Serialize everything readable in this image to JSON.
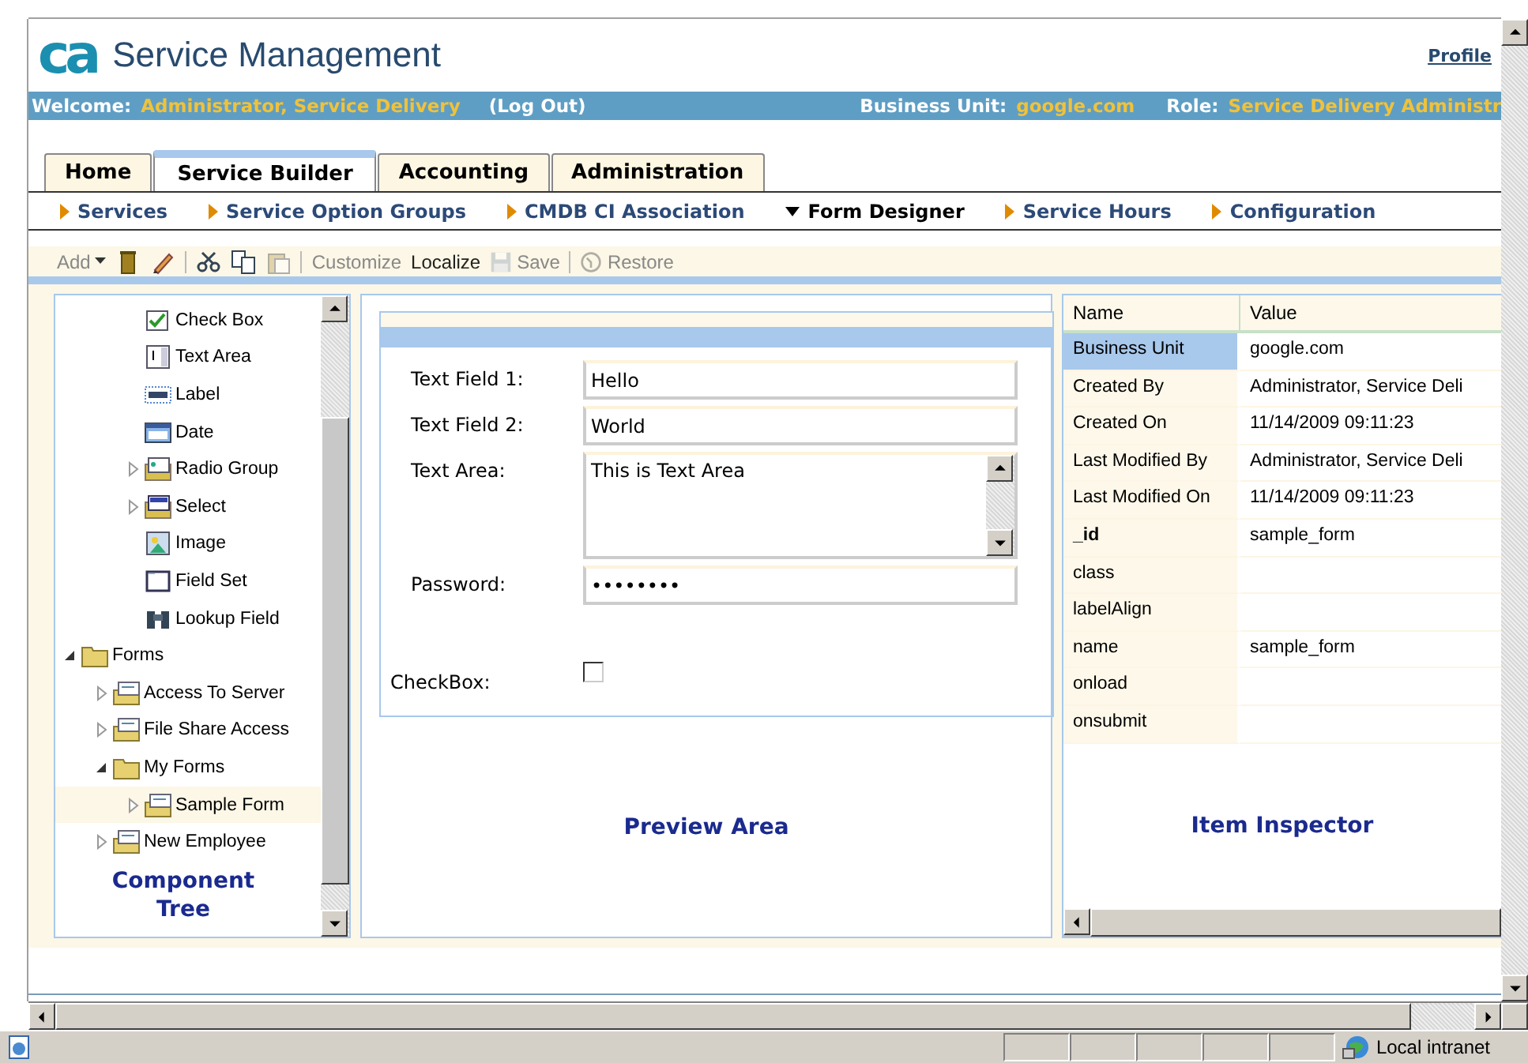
{
  "header": {
    "logo": "ca",
    "title": "Service Management",
    "profile": "Profile"
  },
  "welcome_bar": {
    "welcome_label": "Welcome:",
    "user": "Administrator, Service Delivery",
    "log_out": "(Log Out)",
    "business_unit_label": "Business Unit:",
    "business_unit": "google.com",
    "role_label": "Role:",
    "role": "Service Delivery Administr"
  },
  "tabs": [
    {
      "label": "Home",
      "selected": false
    },
    {
      "label": "Service Builder",
      "selected": true
    },
    {
      "label": "Accounting",
      "selected": false
    },
    {
      "label": "Administration",
      "selected": false
    }
  ],
  "sub_nav": [
    {
      "label": "Services",
      "selected": false
    },
    {
      "label": "Service Option Groups",
      "selected": false
    },
    {
      "label": "CMDB CI Association",
      "selected": false
    },
    {
      "label": "Form Designer",
      "selected": true
    },
    {
      "label": "Service Hours",
      "selected": false
    },
    {
      "label": "Configuration",
      "selected": false
    }
  ],
  "toolbar": {
    "add": {
      "label": "Add",
      "disabled": true
    },
    "buttons": [
      {
        "label": "Customize",
        "disabled": true
      },
      {
        "label": "Localize",
        "disabled": false
      },
      {
        "label": "Save",
        "disabled": true
      },
      {
        "label": "Restore",
        "disabled": true
      }
    ]
  },
  "component_tree": {
    "continued_items": [
      {
        "label": "Check Box",
        "kind": "checkbox"
      },
      {
        "label": "Text Area",
        "kind": "textarea"
      },
      {
        "label": "Label",
        "kind": "label"
      },
      {
        "label": "Date",
        "kind": "date"
      },
      {
        "label": "Radio Group",
        "kind": "radio",
        "expanded": false
      },
      {
        "label": "Select",
        "kind": "select",
        "expanded": false
      },
      {
        "label": "Image",
        "kind": "image"
      },
      {
        "label": "Field Set",
        "kind": "fieldset"
      },
      {
        "label": "Lookup Field",
        "kind": "lookup"
      }
    ],
    "items": [
      {
        "label": "Forms",
        "kind": "folder",
        "expanded": true,
        "selected": false,
        "children": [
          {
            "label": "Access To Server",
            "kind": "form",
            "expanded": false,
            "selected": false
          },
          {
            "label": "File Share Access",
            "kind": "form",
            "expanded": false,
            "selected": false
          },
          {
            "label": "My Forms",
            "kind": "folder",
            "expanded": true,
            "selected": false,
            "children": [
              {
                "label": "Sample Form",
                "kind": "form",
                "expanded": false,
                "selected": true
              }
            ]
          },
          {
            "label": "New Employee",
            "kind": "form",
            "expanded": false,
            "selected": false
          }
        ]
      }
    ],
    "caption": "Component Tree"
  },
  "preview": {
    "fields": [
      {
        "kind": "text",
        "label": "Text Field 1:",
        "value": "Hello"
      },
      {
        "kind": "text",
        "label": "Text Field 2:",
        "value": "World"
      },
      {
        "kind": "textarea",
        "label": "Text Area:",
        "value": "This is Text Area"
      },
      {
        "kind": "password",
        "label": "Password:",
        "value": "••••••••"
      },
      {
        "kind": "checkbox",
        "label": "CheckBox:",
        "checked": false
      }
    ],
    "caption": "Preview Area"
  },
  "inspector": {
    "columns": [
      "Name",
      "Value"
    ],
    "rows": [
      {
        "name": "Business Unit",
        "value": "google.com",
        "selected": true,
        "emphasized": false
      },
      {
        "name": "Created By",
        "value": "Administrator, Service Deli",
        "selected": false,
        "emphasized": false
      },
      {
        "name": "Created On",
        "value": "11/14/2009 09:11:23",
        "selected": false,
        "emphasized": false
      },
      {
        "name": "Last Modified By",
        "value": "Administrator, Service Deli",
        "selected": false,
        "emphasized": false
      },
      {
        "name": "Last Modified On",
        "value": "11/14/2009 09:11:23",
        "selected": false,
        "emphasized": false
      },
      {
        "name": "_id",
        "value": "sample_form",
        "selected": false,
        "emphasized": true
      },
      {
        "name": "class",
        "selected": false,
        "emphasized": false
      },
      {
        "name": "labelAlign",
        "selected": false,
        "emphasized": false
      },
      {
        "name": "name",
        "value": "sample_form",
        "selected": false,
        "emphasized": false
      },
      {
        "name": "onload",
        "selected": false,
        "emphasized": false
      },
      {
        "name": "onsubmit",
        "selected": false,
        "emphasized": false
      }
    ],
    "caption": "Item Inspector"
  },
  "status_bar": {
    "zone": "Local intranet"
  }
}
